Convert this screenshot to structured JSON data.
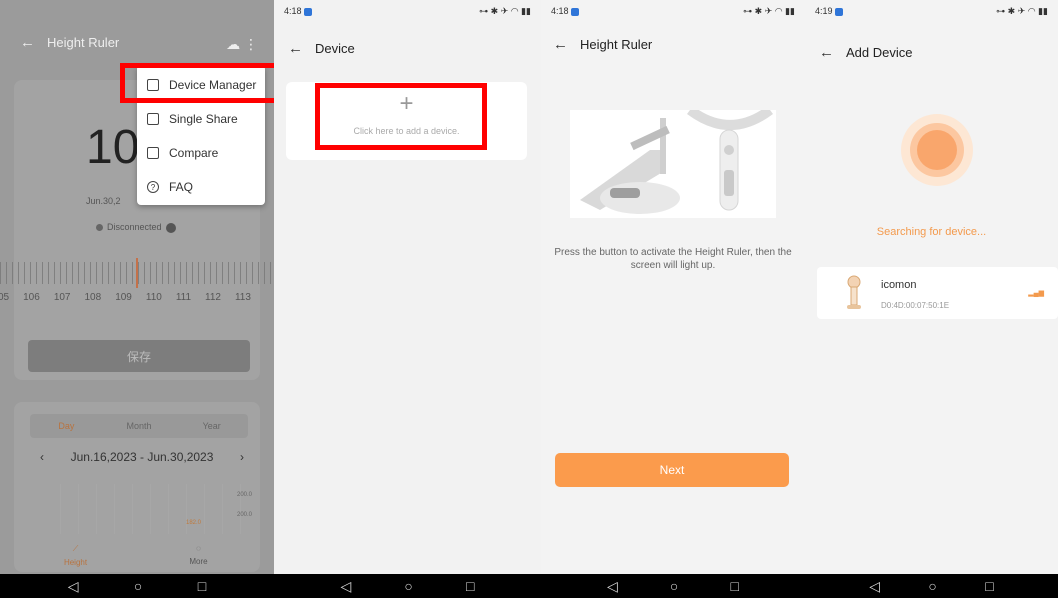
{
  "colors": {
    "accent": "#fb9b4c",
    "highlight": "#ff0000",
    "nav_bar": "#000000"
  },
  "android_nav": {
    "back": "◁",
    "home": "○",
    "recents": "□"
  },
  "screen1": {
    "title": "Height Ruler",
    "value_partial": "10",
    "date_partial": "Jun.30,2",
    "status": "Disconnected",
    "ruler_ticks": [
      "05",
      "106",
      "107",
      "108",
      "109",
      "110",
      "111",
      "112",
      "113"
    ],
    "save_label": "保存",
    "tabs": [
      "Day",
      "Month",
      "Year"
    ],
    "date_range": "Jun.16,2023 - Jun.30,2023",
    "chart_axis": [
      "200.0",
      "200.0"
    ],
    "bar_label": "182.0",
    "bottom_nav": [
      "Height",
      "More"
    ],
    "menu": {
      "items": [
        {
          "label": "Device Manager",
          "icon": "device-manager-icon"
        },
        {
          "label": "Single Share",
          "icon": "share-icon"
        },
        {
          "label": "Compare",
          "icon": "compare-icon"
        },
        {
          "label": "FAQ",
          "icon": "faq-icon"
        }
      ]
    }
  },
  "screen2": {
    "time": "4:18",
    "title": "Device",
    "add_text": "Click here to add a device."
  },
  "screen3": {
    "time": "4:18",
    "title": "Height Ruler",
    "instruction": "Press the button to activate the Height Ruler, then the screen will light up.",
    "next_label": "Next"
  },
  "screen4": {
    "time": "4:19",
    "title": "Add Device",
    "searching_text": "Searching for device...",
    "device_name": "icomon",
    "device_mac": "D0:4D:00:07:50:1E"
  }
}
